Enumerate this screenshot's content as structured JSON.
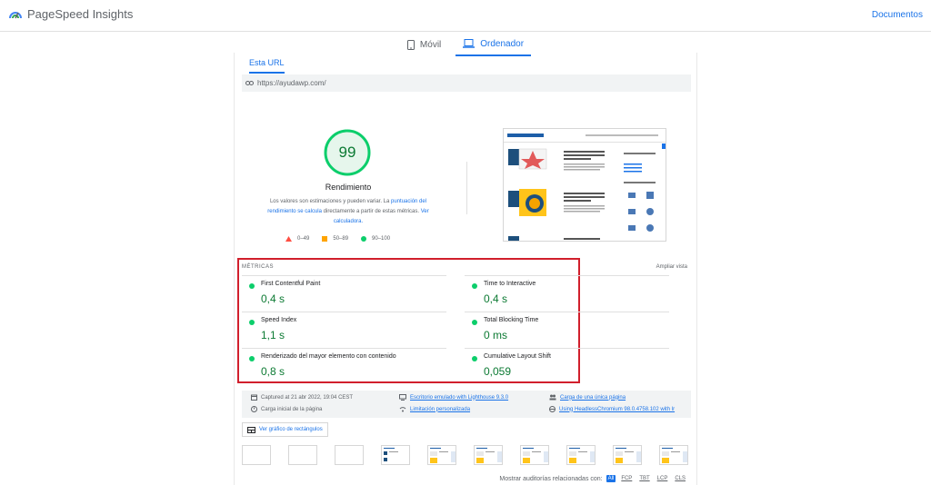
{
  "header": {
    "app_name": "PageSpeed Insights",
    "docs_link": "Documentos"
  },
  "device_tabs": [
    {
      "label": "Móvil",
      "active": false
    },
    {
      "label": "Ordenador",
      "active": true
    }
  ],
  "url_tab": "Esta URL",
  "url": "https://ayudawp.com/",
  "score": {
    "value": "99",
    "fraction": 0.99,
    "title": "Rendimiento",
    "desc_part1": "Los valores son estimaciones y pueden variar. La ",
    "desc_link1": "puntuación del rendimiento se calcula",
    "desc_part2": " directamente a partir de estas métricas. ",
    "desc_link2": "Ver calculadora."
  },
  "legend": {
    "poor": "0–49",
    "average": "50–89",
    "good": "90–100"
  },
  "metrics": {
    "title": "MÉTRICAS",
    "expand": "Ampliar vista",
    "items": [
      {
        "label": "First Contentful Paint",
        "value": "0,4 s"
      },
      {
        "label": "Time to Interactive",
        "value": "0,4 s"
      },
      {
        "label": "Speed Index",
        "value": "1,1 s"
      },
      {
        "label": "Total Blocking Time",
        "value": "0 ms"
      },
      {
        "label": "Renderizado del mayor elemento con contenido",
        "value": "0,8 s"
      },
      {
        "label": "Cumulative Layout Shift",
        "value": "0,059"
      }
    ]
  },
  "info": {
    "captured": "Captured at 21 abr 2022, 19:04 CEST",
    "initial_load": "Carga inicial de la página",
    "emulated": "Escritorio emulado with Lighthouse 9.3.0",
    "throttling": "Limitación personalizada",
    "single_load": "Carga de una única página",
    "browser": "Using HeadlessChromium 98.0.4758.102 with lr"
  },
  "treemap_button": "Ver gráfico de rectángulos",
  "audits": {
    "label": "Mostrar auditorías relacionadas con:",
    "chips": [
      "All",
      "FCP",
      "TBT",
      "LCP",
      "CLS"
    ]
  },
  "colors": {
    "good": "#0cce6b",
    "good_text": "#0c7a33",
    "average": "#ffa400",
    "poor": "#ff4e42",
    "accent": "#1a73e8",
    "highlight": "#d11f2c"
  }
}
